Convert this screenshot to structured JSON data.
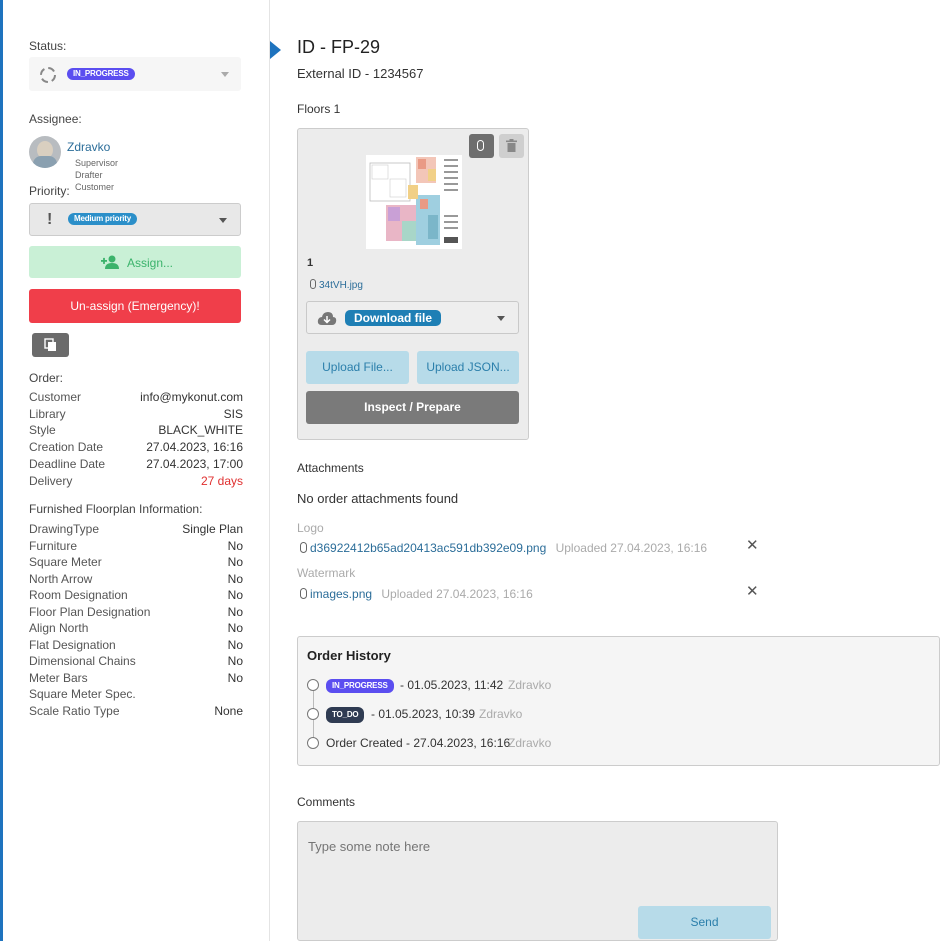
{
  "sidebar": {
    "status_label": "Status:",
    "status_value": "IN_PROGRESS",
    "assignee_label": "Assignee:",
    "assignee_name": "Zdravko",
    "assignee_roles": [
      "Supervisor",
      "Drafter",
      "Customer"
    ],
    "priority_label": "Priority:",
    "priority_value": "Medium priority",
    "assign_button": "Assign...",
    "unassign_button": "Un-assign (Emergency)!",
    "order_label": "Order:",
    "order_rows": [
      {
        "k": "Customer",
        "v": "info@mykonut.com"
      },
      {
        "k": "Library",
        "v": "SIS"
      },
      {
        "k": "Style",
        "v": "BLACK_WHITE"
      },
      {
        "k": "Creation Date",
        "v": "27.04.2023, 16:16"
      },
      {
        "k": "Deadline Date",
        "v": "27.04.2023, 17:00"
      },
      {
        "k": "Delivery",
        "v": "27 days"
      }
    ],
    "furnished_label": "Furnished Floorplan Information:",
    "furnished_rows": [
      {
        "k": "DrawingType",
        "v": "Single Plan"
      },
      {
        "k": "Furniture",
        "v": "No"
      },
      {
        "k": "Square Meter",
        "v": "No"
      },
      {
        "k": "North Arrow",
        "v": "No"
      },
      {
        "k": "Room Designation",
        "v": "No"
      },
      {
        "k": "Floor Plan Designation",
        "v": "No"
      },
      {
        "k": "Align North",
        "v": "No"
      },
      {
        "k": "Flat Designation",
        "v": "No"
      },
      {
        "k": "Dimensional Chains",
        "v": "No"
      },
      {
        "k": "Meter Bars",
        "v": "No"
      },
      {
        "k": "Square Meter Spec.",
        "v": ""
      },
      {
        "k": "Scale Ratio Type",
        "v": "None"
      }
    ]
  },
  "main": {
    "title": "ID - FP-29",
    "external_id": "External ID - 1234567",
    "floors_label": "Floors 1",
    "floor_card": {
      "number": "1",
      "file_name": "34tVH.jpg",
      "download_label": "Download file",
      "upload_file": "Upload File...",
      "upload_json": "Upload JSON...",
      "inspect": "Inspect / Prepare"
    },
    "attachments_label": "Attachments",
    "no_attachments": "No order attachments found",
    "logo_label": "Logo",
    "logo_file": "d36922412b65ad20413ac591db392e09.png",
    "logo_uploaded": "Uploaded 27.04.2023, 16:16",
    "watermark_label": "Watermark",
    "watermark_file": "images.png",
    "watermark_uploaded": "Uploaded 27.04.2023, 16:16",
    "history_title": "Order History",
    "history": [
      {
        "badge": "IN_PROGRESS",
        "text": "- 01.05.2023, 11:42",
        "user": "Zdravko"
      },
      {
        "badge": "TO_DO",
        "text": "- 01.05.2023, 10:39",
        "user": "Zdravko"
      },
      {
        "badge": "",
        "text": "Order Created - 27.04.2023, 16:16",
        "user": "Zdravko"
      }
    ],
    "comments_label": "Comments",
    "comment_placeholder": "Type some note here",
    "send_button": "Send"
  },
  "colors": {
    "in_progress": "#5b4ef0",
    "todo": "#2f3b52",
    "priority_badge": "#2b8fc9",
    "assign_bg": "#c9f0d6",
    "assign_fg": "#3bb36b",
    "unassign_bg": "#f03e4a",
    "download_badge": "#1e7fb5",
    "upload_bg": "#b7dbe9",
    "upload_fg": "#2b7fab",
    "inspect_bg": "#7a7a7a",
    "delivery_red": "#e03030"
  }
}
